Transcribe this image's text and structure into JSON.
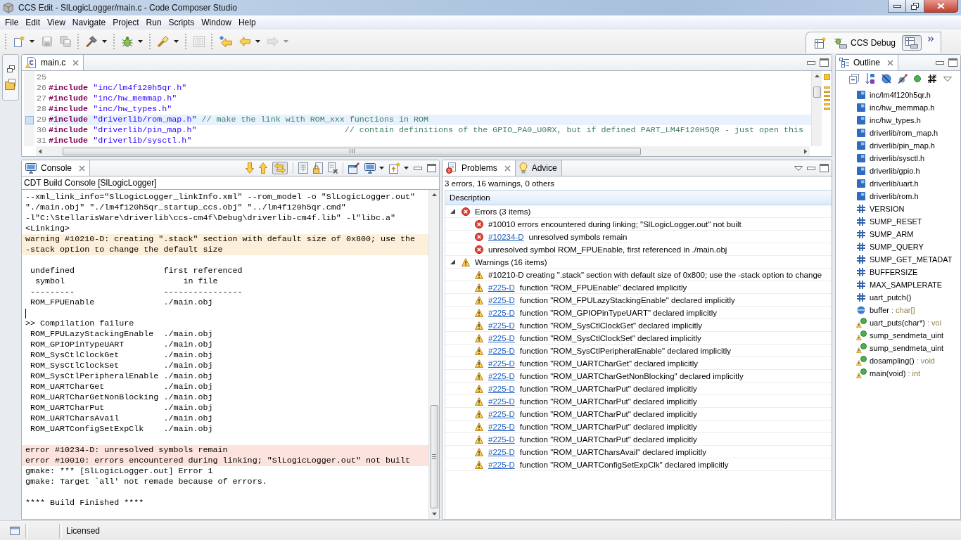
{
  "window": {
    "title": "CCS Edit - SlLogicLogger/main.c - Code Composer Studio"
  },
  "menu": [
    "File",
    "Edit",
    "View",
    "Navigate",
    "Project",
    "Run",
    "Scripts",
    "Window",
    "Help"
  ],
  "toolbar": {
    "groups": [
      {
        "buttons": [
          {
            "kind": "new",
            "dropdown": true,
            "disabled": false
          },
          {
            "kind": "save",
            "dropdown": false,
            "disabled": true
          },
          {
            "kind": "save_all",
            "dropdown": false,
            "disabled": true
          }
        ]
      },
      {
        "buttons": [
          {
            "kind": "build",
            "dropdown": true,
            "disabled": false
          }
        ]
      },
      {
        "buttons": [
          {
            "kind": "debug",
            "dropdown": true,
            "disabled": false
          }
        ]
      },
      {
        "buttons": [
          {
            "kind": "flashlight",
            "dropdown": true,
            "disabled": false
          }
        ]
      },
      {
        "buttons": [
          {
            "kind": "panel",
            "dropdown": false,
            "disabled": true
          }
        ]
      },
      {
        "buttons": [
          {
            "kind": "last_edit",
            "dropdown": false,
            "disabled": false
          },
          {
            "kind": "back",
            "dropdown": true,
            "disabled": false
          },
          {
            "kind": "forward",
            "dropdown": true,
            "disabled": true
          }
        ]
      }
    ]
  },
  "perspectives": [
    {
      "kind": "debug",
      "label": "CCS Debug",
      "selected": false
    },
    {
      "kind": "edit",
      "selected": true
    }
  ],
  "editor": {
    "tab": {
      "label": "main.c",
      "selected": true
    },
    "lines": [
      {
        "number": "25",
        "current": false
      },
      {
        "number": "26",
        "current": false,
        "tokens": [
          {
            "kind": "keyword",
            "text": "#include"
          },
          {
            "kind": "string",
            "text": "\"inc/lm4f120h5qr.h\""
          }
        ]
      },
      {
        "number": "27",
        "current": false,
        "tokens": [
          {
            "kind": "keyword",
            "text": "#include"
          },
          {
            "kind": "string",
            "text": "\"inc/hw_memmap.h\""
          }
        ]
      },
      {
        "number": "28",
        "current": false,
        "tokens": [
          {
            "kind": "keyword",
            "text": "#include"
          },
          {
            "kind": "string",
            "text": "\"inc/hw_types.h\""
          }
        ]
      },
      {
        "number": "29",
        "current": true,
        "tokens": [
          {
            "kind": "keyword",
            "text": "#include"
          },
          {
            "kind": "string",
            "text": "\"driverlib/rom_map.h\""
          },
          {
            "kind": "comment",
            "text": "// make the link with ROM_xxx functions in ROM"
          }
        ]
      },
      {
        "number": "30",
        "current": false,
        "tokens": [
          {
            "kind": "keyword",
            "text": "#include"
          },
          {
            "kind": "string",
            "text": "\"driverlib/pin_map.h\""
          },
          {
            "kind": "aligned_comment",
            "text": "// contain definitions of the GPIO_PA0_U0RX, but if defined PART_LM4F120H5QR - just open this"
          }
        ]
      },
      {
        "number": "31",
        "current": false,
        "tokens": [
          {
            "kind": "keyword",
            "text": "#include"
          },
          {
            "kind": "string",
            "text": "\"driverlib/sysctl.h\""
          }
        ]
      }
    ]
  },
  "console": {
    "tab": {
      "label": "Console",
      "selected": true
    },
    "toggle_pressed": true,
    "title": "CDT Build Console [SlLogicLogger]",
    "lines": [
      {
        "kind": "normal",
        "text": "--xml_link_info=\"SlLogicLogger_linkInfo.xml\" --rom_model -o \"SlLogicLogger.out\""
      },
      {
        "kind": "normal",
        "text": "\"./main.obj\" \"./lm4f120h5qr_startup_ccs.obj\" \"../lm4f120h5qr.cmd\""
      },
      {
        "kind": "normal",
        "text": "-l\"C:\\StellarisWare\\driverlib\\ccs-cm4f\\Debug\\driverlib-cm4f.lib\" -l\"libc.a\""
      },
      {
        "kind": "normal",
        "text": "<Linking>"
      },
      {
        "kind": "warning",
        "text": "warning #10210-D: creating \".stack\" section with default size of 0x800; use the"
      },
      {
        "kind": "warning",
        "text": "-stack option to change the default size"
      },
      {
        "kind": "blank"
      },
      {
        "kind": "normal",
        "text": " undefined                  first referenced"
      },
      {
        "kind": "normal",
        "text": "  symbol                        in file"
      },
      {
        "kind": "normal",
        "text": " ---------                  ----------------"
      },
      {
        "kind": "normal",
        "text": " ROM_FPUEnable              ./main.obj"
      },
      {
        "kind": "caret"
      },
      {
        "kind": "normal",
        "text": ">> Compilation failure"
      },
      {
        "kind": "normal",
        "text": " ROM_FPULazyStackingEnable  ./main.obj"
      },
      {
        "kind": "normal",
        "text": " ROM_GPIOPinTypeUART        ./main.obj"
      },
      {
        "kind": "normal",
        "text": " ROM_SysCtlClockGet         ./main.obj"
      },
      {
        "kind": "normal",
        "text": " ROM_SysCtlClockSet         ./main.obj"
      },
      {
        "kind": "normal",
        "text": " ROM_SysCtlPeripheralEnable ./main.obj"
      },
      {
        "kind": "normal",
        "text": " ROM_UARTCharGet            ./main.obj"
      },
      {
        "kind": "normal",
        "text": " ROM_UARTCharGetNonBlocking ./main.obj"
      },
      {
        "kind": "normal",
        "text": " ROM_UARTCharPut            ./main.obj"
      },
      {
        "kind": "normal",
        "text": " ROM_UARTCharsAvail         ./main.obj"
      },
      {
        "kind": "normal",
        "text": " ROM_UARTConfigSetExpClk    ./main.obj"
      },
      {
        "kind": "blank"
      },
      {
        "kind": "error",
        "text": "error #10234-D: unresolved symbols remain"
      },
      {
        "kind": "error",
        "text": "error #10010: errors encountered during linking; \"SlLogicLogger.out\" not built"
      },
      {
        "kind": "normal",
        "text": "gmake: *** [SlLogicLogger.out] Error 1"
      },
      {
        "kind": "normal",
        "text": "gmake: Target `all' not remade because of errors."
      },
      {
        "kind": "blank"
      },
      {
        "kind": "normal",
        "text": "**** Build Finished ****"
      }
    ]
  },
  "problems": {
    "tabs": [
      {
        "label": "Problems",
        "selected": true
      },
      {
        "label": "Advice",
        "selected": false
      }
    ],
    "summary": "3 errors, 16 warnings, 0 others",
    "columns": [
      "Description"
    ],
    "groups": [
      {
        "kind": "error",
        "label": "Errors (3 items)",
        "expanded": true,
        "children": [
          {
            "text": "#10010 errors encountered during linking; \"SlLogicLogger.out\" not built"
          },
          {
            "link": "#10234-D",
            "text": "unresolved symbols remain"
          },
          {
            "text": "unresolved symbol ROM_FPUEnable, first referenced in ./main.obj"
          }
        ]
      },
      {
        "kind": "warning",
        "label": "Warnings (16 items)",
        "expanded": true,
        "children": [
          {
            "text": "#10210-D creating \".stack\" section with default size of 0x800; use the -stack option to change"
          },
          {
            "link": "#225-D",
            "text": "function \"ROM_FPUEnable\" declared implicitly"
          },
          {
            "link": "#225-D",
            "text": "function \"ROM_FPULazyStackingEnable\" declared implicitly"
          },
          {
            "link": "#225-D",
            "text": "function \"ROM_GPIOPinTypeUART\" declared implicitly"
          },
          {
            "link": "#225-D",
            "text": "function \"ROM_SysCtlClockGet\" declared implicitly"
          },
          {
            "link": "#225-D",
            "text": "function \"ROM_SysCtlClockSet\" declared implicitly"
          },
          {
            "link": "#225-D",
            "text": "function \"ROM_SysCtlPeripheralEnable\" declared implicitly"
          },
          {
            "link": "#225-D",
            "text": "function \"ROM_UARTCharGet\" declared implicitly"
          },
          {
            "link": "#225-D",
            "text": "function \"ROM_UARTCharGetNonBlocking\" declared implicitly"
          },
          {
            "link": "#225-D",
            "text": "function \"ROM_UARTCharPut\" declared implicitly"
          },
          {
            "link": "#225-D",
            "text": "function \"ROM_UARTCharPut\" declared implicitly"
          },
          {
            "link": "#225-D",
            "text": "function \"ROM_UARTCharPut\" declared implicitly"
          },
          {
            "link": "#225-D",
            "text": "function \"ROM_UARTCharPut\" declared implicitly"
          },
          {
            "link": "#225-D",
            "text": "function \"ROM_UARTCharPut\" declared implicitly"
          },
          {
            "link": "#225-D",
            "text": "function \"ROM_UARTCharsAvail\" declared implicitly"
          },
          {
            "link": "#225-D",
            "text": "function \"ROM_UARTConfigSetExpClk\" declared implicitly"
          }
        ]
      }
    ]
  },
  "outline": {
    "tab": {
      "label": "Outline",
      "selected": true
    },
    "items": [
      {
        "kind": "include",
        "name": "inc/lm4f120h5qr.h"
      },
      {
        "kind": "include",
        "name": "inc/hw_memmap.h"
      },
      {
        "kind": "include",
        "name": "inc/hw_types.h"
      },
      {
        "kind": "include",
        "name": "driverlib/rom_map.h"
      },
      {
        "kind": "include",
        "name": "driverlib/pin_map.h"
      },
      {
        "kind": "include",
        "name": "driverlib/sysctl.h"
      },
      {
        "kind": "include",
        "name": "driverlib/gpio.h"
      },
      {
        "kind": "include",
        "name": "driverlib/uart.h"
      },
      {
        "kind": "include",
        "name": "driverlib/rom.h"
      },
      {
        "kind": "macro",
        "name": "VERSION"
      },
      {
        "kind": "macro",
        "name": "SUMP_RESET"
      },
      {
        "kind": "macro",
        "name": "SUMP_ARM"
      },
      {
        "kind": "macro",
        "name": "SUMP_QUERY"
      },
      {
        "kind": "macro",
        "name": "SUMP_GET_METADAT"
      },
      {
        "kind": "macro",
        "name": "BUFFERSIZE"
      },
      {
        "kind": "macro",
        "name": "MAX_SAMPLERATE"
      },
      {
        "kind": "macro",
        "name": "uart_putch()"
      },
      {
        "kind": "variable",
        "name": "buffer",
        "type": ": char[]"
      },
      {
        "kind": "function",
        "name": "uart_puts(char*)",
        "type": ": voi",
        "warning": true
      },
      {
        "kind": "function",
        "name": "sump_sendmeta_uint",
        "warning": true
      },
      {
        "kind": "function",
        "name": "sump_sendmeta_uint",
        "warning": true
      },
      {
        "kind": "function",
        "name": "dosampling()",
        "type": ": void",
        "warning": true
      },
      {
        "kind": "function",
        "name": "main(void)",
        "type": ": int",
        "warning": true
      }
    ]
  },
  "status_bar": {
    "text": "Licensed"
  }
}
